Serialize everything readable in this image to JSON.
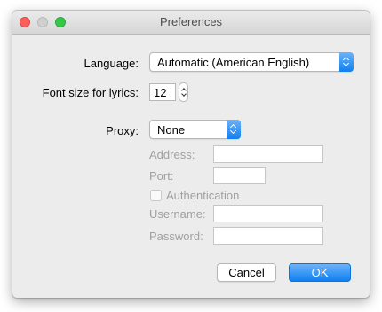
{
  "window": {
    "title": "Preferences"
  },
  "language": {
    "label": "Language:",
    "selected": "Automatic (American English)"
  },
  "font_size": {
    "label": "Font size for lyrics:",
    "value": "12"
  },
  "proxy": {
    "label": "Proxy:",
    "selected": "None",
    "address_label": "Address:",
    "address_value": "",
    "port_label": "Port:",
    "port_value": "",
    "authentication_label": "Authentication",
    "authentication_checked": false,
    "username_label": "Username:",
    "username_value": "",
    "password_label": "Password:",
    "password_value": ""
  },
  "buttons": {
    "cancel": "Cancel",
    "ok": "OK"
  }
}
